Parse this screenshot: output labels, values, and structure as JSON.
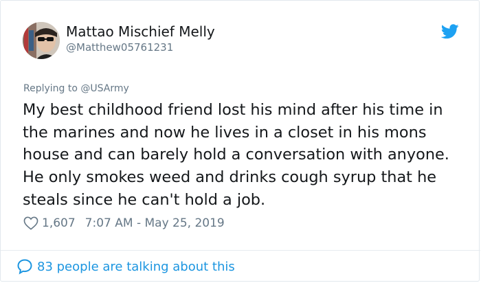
{
  "author": {
    "display_name": "Mattao Mischief Melly",
    "handle": "@Matthew05761231"
  },
  "reply": {
    "prefix": "Replying to",
    "mention": "@USArmy"
  },
  "tweet": {
    "text": "My best childhood friend lost his mind after his time in the marines and now he lives in a closet in his mons house and can barely hold a conversation with anyone. He only smokes weed and drinks cough syrup that he steals since he can't hold a job."
  },
  "meta": {
    "likes": "1,607",
    "timestamp": "7:07 AM - May 25, 2019"
  },
  "footer": {
    "talking_text": "83 people are talking about this"
  },
  "icons": {
    "brand": "twitter-bird-icon",
    "like": "heart-icon",
    "reply": "speech-bubble-icon"
  },
  "colors": {
    "brand_blue": "#1da1f2",
    "link_blue": "#1b95e0",
    "secondary_text": "#657786",
    "primary_text": "#14171a"
  }
}
